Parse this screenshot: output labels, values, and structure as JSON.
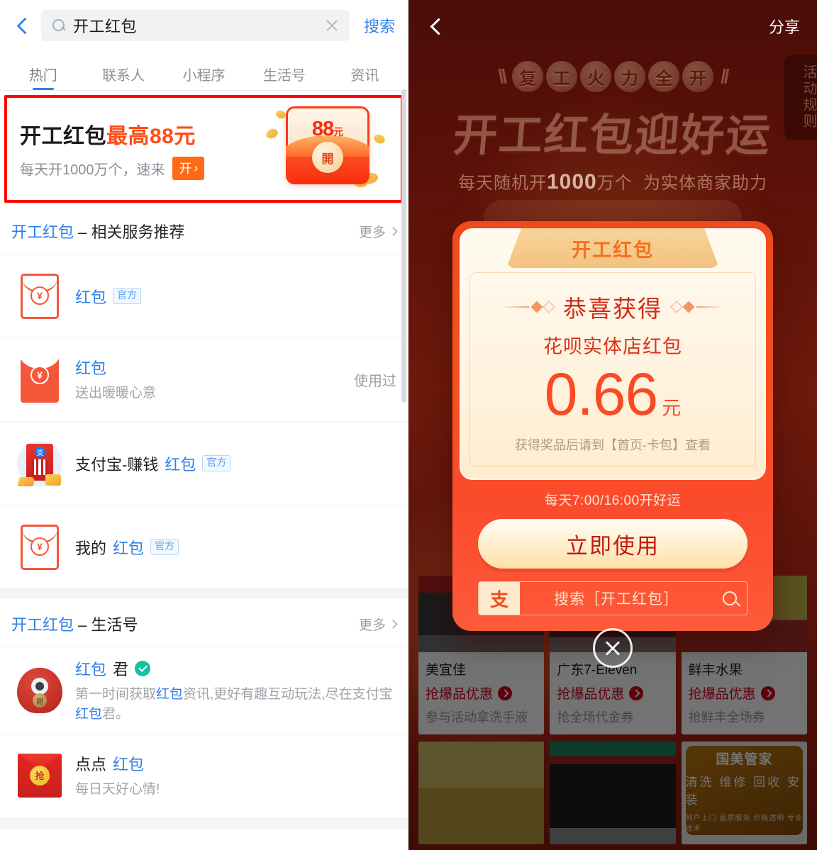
{
  "left": {
    "search": {
      "back_icon": "back-chevron-icon",
      "search_icon": "magnifier-icon",
      "query": "开工红包",
      "placeholder": "搜索",
      "clear_icon": "clear-x-icon",
      "submit_label": "搜索"
    },
    "tabs": [
      {
        "label": "热门",
        "active": true
      },
      {
        "label": "联系人",
        "active": false
      },
      {
        "label": "小程序",
        "active": false
      },
      {
        "label": "生活号",
        "active": false
      },
      {
        "label": "资讯",
        "active": false
      }
    ],
    "promo": {
      "title_plain": "开工红包",
      "title_highlight": "最高88元",
      "subtitle": "每天开1000万个，速来",
      "button_label": "开",
      "button_chevron": "›",
      "envelope_amount": "88",
      "envelope_unit": "元",
      "envelope_open_char": "開",
      "border_color": "#ff0000",
      "accent_color": "#ff6a13"
    },
    "section_services": {
      "title_keyword": "开工红包",
      "title_rest": " – 相关服务推荐",
      "more_label": "更多",
      "items": [
        {
          "icon": "red-envelope-outline-icon",
          "title_pre": "",
          "title_kw": "红包",
          "title_post": "",
          "badge": "官方",
          "sub": "",
          "right": ""
        },
        {
          "icon": "red-envelope-filled-icon",
          "title_pre": "",
          "title_kw": "红包",
          "title_post": "",
          "badge": "",
          "sub": "送出暖暖心意",
          "right": "使用过"
        },
        {
          "icon": "alipay-earn-packet-icon",
          "title_pre": "支付宝-赚钱",
          "title_kw": "红包",
          "title_post": "",
          "badge": "官方",
          "sub": "",
          "right": ""
        },
        {
          "icon": "red-envelope-outline-icon",
          "title_pre": "我的",
          "title_kw": "红包",
          "title_post": "",
          "badge": "官方",
          "sub": "",
          "right": ""
        }
      ]
    },
    "section_life": {
      "title_keyword": "开工红包",
      "title_rest": " – 生活号",
      "more_label": "更多",
      "items": [
        {
          "icon": "mascot-avatar-icon",
          "title_pre": "",
          "title_kw": "红包",
          "title_post": "君",
          "verified": true,
          "sub_1": "第一时间获取",
          "sub_kw1": "红包",
          "sub_2": "资讯,更好有趣互动玩法,尽在支付宝",
          "sub_kw2": "红包",
          "sub_3": "君。"
        },
        {
          "icon": "dot-red-packet-icon",
          "title_pre": "点点",
          "title_kw": "红包",
          "title_post": "",
          "verified": false,
          "sub_1": "每日天好心情!",
          "sub_kw1": "",
          "sub_2": "",
          "sub_kw2": "",
          "sub_3": ""
        }
      ]
    }
  },
  "right": {
    "topbar": {
      "back_icon": "back-chevron-icon",
      "share_label": "分享"
    },
    "hero": {
      "pills": [
        "复",
        "工",
        "火",
        "力",
        "全",
        "开"
      ],
      "title": "开工红包迎好运",
      "sub_pre": "每天随机开",
      "sub_num": "1000",
      "sub_mid": "万个",
      "sub_post": "为实体商家助力"
    },
    "rules_tab": "活动规则",
    "modal": {
      "ribbon_label": "开工红包",
      "congrats": "恭喜获得",
      "prize_name": "花呗实体店红包",
      "amount": "0.66",
      "amount_unit": "元",
      "note": "获得奖品后请到【首页-卡包】查看",
      "time_note": "每天7:00/16:00开好运",
      "use_button": "立即使用",
      "search_hint_logo": "支",
      "search_hint_text": "搜索［开工红包］",
      "search_icon": "magnifier-icon",
      "bg_color": "#f4521d",
      "amount_color": "#fb4a22"
    },
    "close_icon": "close-circle-icon",
    "merchants": [
      {
        "name": "美宜佳",
        "deal": "抢爆品优惠",
        "desc": "参与活动拿洗手液",
        "thumb": "t-meiyijia"
      },
      {
        "name": "广东7-Eleven",
        "deal": "抢爆品优惠",
        "desc": "抢全场代金券",
        "thumb": "t-711"
      },
      {
        "name": "鲜丰水果",
        "deal": "抢爆品优惠",
        "desc": "抢鲜丰全场券",
        "thumb": "t-fruit"
      }
    ],
    "merchants_row2": [
      {
        "thumb": "t-super",
        "gome": false
      },
      {
        "thumb": "t-coffee",
        "gome": false
      },
      {
        "thumb": "t-gome",
        "gome": true,
        "logo": "国美管家",
        "services": "清洗 维修 回收 安装",
        "tiny": "到户上门 品质服务 价格透明 专业技术"
      }
    ]
  }
}
